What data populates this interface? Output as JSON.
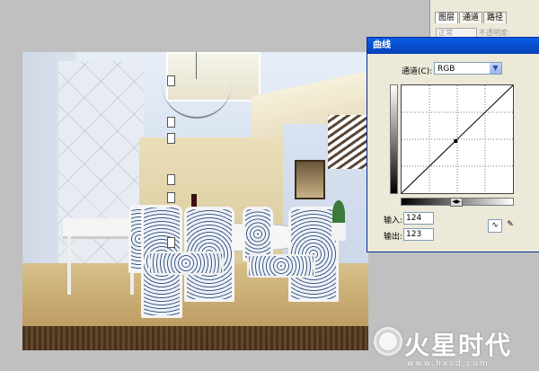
{
  "layers_palette": {
    "tabs": [
      "图层",
      "通道",
      "路径"
    ],
    "blend_mode": "正常",
    "opacity_label": "不透明度:"
  },
  "curves_dialog": {
    "title": "曲线",
    "channel_label": "通道(C):",
    "channel_value": "RGB",
    "input_label": "输入:",
    "input_value": "124",
    "output_label": "输出:",
    "output_value": "123",
    "curve_point": {
      "input": 124,
      "output": 123
    },
    "icons": [
      "curve-tool-icon",
      "pencil-icon",
      "chevron-down-icon",
      "slider-toggle-icon"
    ]
  },
  "watermark": {
    "brand": "火星时代",
    "url": "www.hxsd.com"
  },
  "colors": {
    "title_bar": "#0a5ce6",
    "dialog_bg": "#ece9d8",
    "workspace_bg": "#c0c0c0"
  }
}
